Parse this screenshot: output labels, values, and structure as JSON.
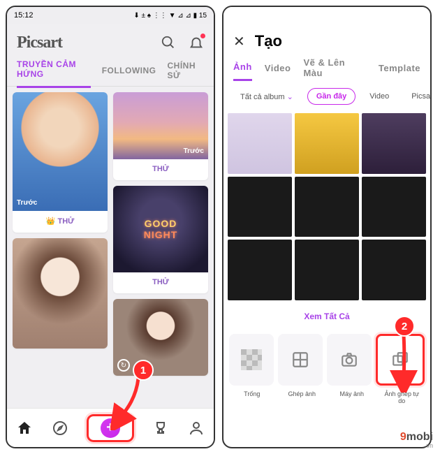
{
  "status": {
    "time": "15:12",
    "icons": "⬇ ± ♠  ⋮⋮ ▼ ⊿ ⊿ ▮ 15"
  },
  "screen1": {
    "logo": "Picsart",
    "tabs": {
      "a": "TRUYỀN CẢM HỨNG",
      "b": "FOLLOWING",
      "c": "CHÍNH SỬ"
    },
    "btn_try": "THỬ",
    "before": "Trước",
    "badge_crown_try": "👑 THỬ"
  },
  "screen2": {
    "title": "Tạo",
    "tabs": {
      "a": "Ảnh",
      "b": "Video",
      "c": "Vẽ & Lên Màu",
      "d": "Template"
    },
    "filters": {
      "album": "Tất cả album",
      "recent": "Gần đây",
      "video": "Video",
      "picsart": "Picsa"
    },
    "see_all": "Xem Tất Cả",
    "tools": {
      "empty": "Trống",
      "collage": "Ghép ảnh",
      "camera": "Máy ảnh",
      "free": "Ảnh ghép tự\ndo"
    }
  },
  "badges": {
    "one": "1",
    "two": "2"
  },
  "watermark": {
    "brand_a": "9",
    "brand_b": "mobi",
    "tld": ".vn"
  }
}
